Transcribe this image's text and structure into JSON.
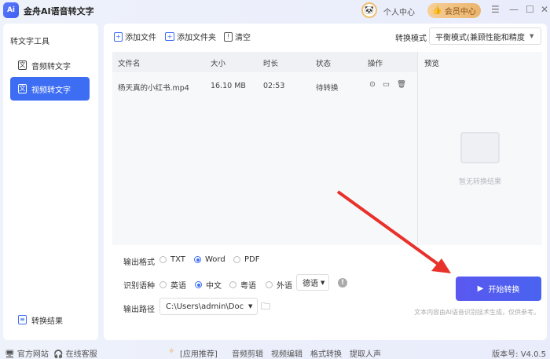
{
  "app": {
    "logo": "Ai",
    "title": "金舟AI语音转文字",
    "personal_center": "个人中心",
    "vip_center": "会员中心"
  },
  "sidebar": {
    "section": "转文字工具",
    "items": [
      {
        "label": "音频转文字"
      },
      {
        "label": "视频转文字"
      }
    ],
    "results": "转换结果"
  },
  "toolbar": {
    "add_file": "添加文件",
    "add_folder": "添加文件夹",
    "clear": "清空",
    "mode_label": "转换模式",
    "mode_value": "平衡模式(兼顾性能和精度"
  },
  "table": {
    "headers": [
      "文件名",
      "大小",
      "时长",
      "状态",
      "操作"
    ],
    "rows": [
      {
        "name": "杨天真的小红书.mp4",
        "size": "16.10 MB",
        "duration": "02:53",
        "status": "待转换"
      }
    ]
  },
  "preview": {
    "title": "预览",
    "empty": "暂无转换结果"
  },
  "options": {
    "format_label": "输出格式",
    "formats": [
      "TXT",
      "Word",
      "PDF"
    ],
    "format_selected": "Word",
    "lang_label": "识别语种",
    "langs": [
      "英语",
      "中文",
      "粤语",
      "外语"
    ],
    "lang_selected": "中文",
    "foreign_value": "德语",
    "path_label": "输出路径",
    "path_value": "C:\\Users\\admin\\Doc"
  },
  "start": {
    "label": "开始转换",
    "note": "文本内容由AI语音识别技术生成，仅供参考。"
  },
  "footer": {
    "website": "官方网站",
    "service": "在线客服",
    "recommend": "[应用推荐]",
    "links": [
      "音频剪辑",
      "视频编辑",
      "格式转换",
      "提取人声"
    ],
    "version": "版本号: V4.0.5"
  },
  "colors": {
    "accent": "#3d6df2",
    "arrow": "#e8312a"
  }
}
